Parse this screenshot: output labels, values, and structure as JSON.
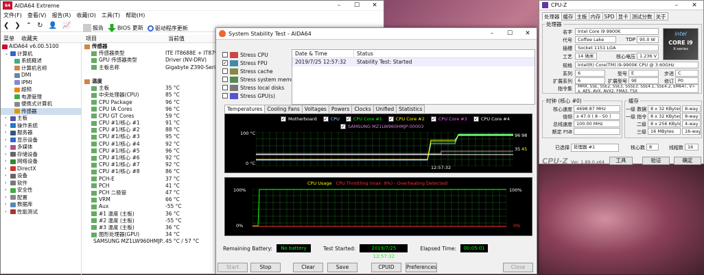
{
  "aida": {
    "title": "AIDA64 Extreme",
    "icon": "64",
    "menu": [
      "文件(F)",
      "查看(V)",
      "报告(R)",
      "收藏(O)",
      "工具(T)",
      "帮助(H)"
    ],
    "toolbar2": [
      "报告",
      "BIOS 更新",
      "驱动程序更新"
    ],
    "col_menu": "菜单",
    "col_fav": "收藏夹",
    "col_item": "项目",
    "col_value": "当前值",
    "version": "AIDA64 v6.00.5100",
    "tree": [
      "计算机",
      "系统概述",
      "计算机名称",
      "DMI",
      "IPMI",
      "超频",
      "电源管理",
      "便携式计算机",
      "传感器",
      "主板",
      "操作系统",
      "服务器",
      "显示设备",
      "多媒体",
      "存储设备",
      "网络设备",
      "DirectX",
      "设备",
      "软件",
      "安全性",
      "配置",
      "数据库",
      "性能测试"
    ],
    "sensors": [
      {
        "n": "传感器",
        "v": "",
        "h": 1
      },
      {
        "n": "传感器类型",
        "v": "ITE IT8688E + IT8795E",
        "h": 0
      },
      {
        "n": "GPU 传感器类型",
        "v": "Driver (NV-DRV)",
        "h": 0
      },
      {
        "n": "主板名称",
        "v": "Gigabyte Z390-Series",
        "h": 0
      },
      {
        "n": "",
        "v": "",
        "h": 0
      },
      {
        "n": "温度",
        "v": "",
        "h": 1
      },
      {
        "n": "主板",
        "v": "35 °C",
        "h": 0
      },
      {
        "n": "中央处理器(CPU)",
        "v": "85 °C",
        "h": 0
      },
      {
        "n": "CPU Package",
        "v": "96 °C",
        "h": 0
      },
      {
        "n": "CPU IA Cores",
        "v": "96 °C",
        "h": 0
      },
      {
        "n": "CPU GT Cores",
        "v": "59 °C",
        "h": 0
      },
      {
        "n": "CPU #1/核心 #1",
        "v": "91 °C",
        "h": 0
      },
      {
        "n": "CPU #1/核心 #2",
        "v": "88 °C",
        "h": 0
      },
      {
        "n": "CPU #1/核心 #3",
        "v": "95 °C",
        "h": 0
      },
      {
        "n": "CPU #1/核心 #4",
        "v": "92 °C",
        "h": 0
      },
      {
        "n": "CPU #1/核心 #5",
        "v": "96 °C",
        "h": 0
      },
      {
        "n": "CPU #1/核心 #6",
        "v": "92 °C",
        "h": 0
      },
      {
        "n": "CPU #1/核心 #7",
        "v": "92 °C",
        "h": 0
      },
      {
        "n": "CPU #1/核心 #8",
        "v": "86 °C",
        "h": 0
      },
      {
        "n": "PCH-E",
        "v": "37 °C",
        "h": 0
      },
      {
        "n": "PCH",
        "v": "41 °C",
        "h": 0
      },
      {
        "n": "PCH 二极管",
        "v": "47 °C",
        "h": 0
      },
      {
        "n": "VRM",
        "v": "66 °C",
        "h": 0
      },
      {
        "n": "Aux",
        "v": "-55 °C",
        "h": 0
      },
      {
        "n": "#1 温度 (主板)",
        "v": "36 °C",
        "h": 0
      },
      {
        "n": "#2 温度 (主板)",
        "v": "-55 °C",
        "h": 0
      },
      {
        "n": "#3 温度 (主板)",
        "v": "36 °C",
        "h": 0
      },
      {
        "n": "图形处理器(GPU)",
        "v": "34 °C",
        "h": 0
      },
      {
        "n": "SAMSUNG MZ1LW960HMJP...",
        "v": "45 °C / 57 °C",
        "h": 0
      }
    ]
  },
  "stab": {
    "title": "System Stability Test - AIDA64",
    "checks": [
      {
        "l": "Stress CPU",
        "c": false
      },
      {
        "l": "Stress FPU",
        "c": true
      },
      {
        "l": "Stress cache",
        "c": false
      },
      {
        "l": "Stress system memory",
        "c": false
      },
      {
        "l": "Stress local disks",
        "c": false
      },
      {
        "l": "Stress GPU(s)",
        "c": false
      }
    ],
    "log_h": [
      "Date & Time",
      "Status"
    ],
    "log_row": [
      "2019/7/25 12:57:32",
      "Stability Test: Started"
    ],
    "tabs": [
      "Temperatures",
      "Cooling Fans",
      "Voltages",
      "Powers",
      "Clocks",
      "Unified",
      "Statistics"
    ],
    "legend": [
      "Motherboard",
      "CPU",
      "CPU Core #1",
      "CPU Core #2",
      "CPU Core #3",
      "CPU Core #4"
    ],
    "legend2": "SAMSUNG MZ1LW960HMJP-00003",
    "t_top": "100 °C",
    "t_bot": "0 °C",
    "t_time": "12:57:32",
    "t_r1": "96",
    "t_r2": "98",
    "t_r3": "35",
    "t_r4": "45",
    "u_title": "CPU Usage",
    "u_throttle": "CPU Throttling (max: 9%) - Overheating Detected!",
    "u_top": "100%",
    "u_bot": "0%",
    "u_rtop": "100%",
    "u_rbot": "0%",
    "rb_l": "Remaining Battery:",
    "rb_v": "No battery",
    "ts_l": "Test Started:",
    "ts_v": "2019/7/25 12:57:32",
    "et_l": "Elapsed Time:",
    "et_v": "00:05:01",
    "buttons": [
      "Start",
      "Stop",
      "Clear",
      "Save",
      "CPUID",
      "Preferences",
      "Close"
    ]
  },
  "cpuz": {
    "title": "CPU-Z",
    "tabs": [
      "处理器",
      "缓存",
      "主板",
      "内存",
      "SPD",
      "显卡",
      "测试分数",
      "关于"
    ],
    "grp_proc": "处理器",
    "name_l": "名字",
    "name": "Intel Core i9 9900K",
    "code_l": "代号",
    "code": "Coffee Lake",
    "tdp_l": "TDP",
    "tdp": "95.0 W",
    "pkg_l": "插槽",
    "pkg": "Socket 1151 LGA",
    "tech_l": "工艺",
    "tech": "14 纳米",
    "volt_l": "核心电压",
    "volt": "1.236 V",
    "spec_l": "规格",
    "spec": "Intel(R) Core(TM) i9-9900K CPU @ 3.60GHz",
    "fam_l": "系列",
    "fam": "6",
    "mod_l": "型号",
    "mod": "E",
    "step_l": "步进",
    "step": "C",
    "efam_l": "扩展系列",
    "efam": "6",
    "emod_l": "扩展型号",
    "emod": "9E",
    "rev_l": "修订",
    "rev": "P0",
    "ins_l": "指令集",
    "ins": "MMX, SSE, SSE2, SSE3, SSSE3, SSE4.1, SSE4.2, EM64T, VT-x, AES, AVX, AVX2, FMA3, TSX",
    "grp_clk": "时钟 (核心 #0)",
    "cs_l": "核心速度",
    "cs": "4698.87 MHz",
    "mul_l": "倍频",
    "mul": "x 47.0 ( 8 - 50 )",
    "bus_l": "总线速度",
    "bus": "100.00 MHz",
    "fsb_l": "额定 FSB",
    "fsb": "",
    "grp_cache": "缓存",
    "l1d_l": "一级 数据",
    "l1d": "8 x 32 KBytes",
    "l1d_w": "8-way",
    "l1i_l": "一级 指令",
    "l1i": "8 x 32 KBytes",
    "l1i_w": "8-way",
    "l2_l": "二级",
    "l2": "8 x 256 KBytes",
    "l2_w": "4-way",
    "l3_l": "三级",
    "l3": "16 MBytes",
    "l3_w": "16-way",
    "sel_l": "已选择",
    "sel": "处理器 #1",
    "cores_l": "核心数",
    "cores": "8",
    "thr_l": "线程数",
    "thr": "16",
    "brand": "CPU-Z",
    "ver": "Ver. 1.89.0.x64",
    "tools": "工具",
    "verify": "验证",
    "ok": "确定",
    "logo1": "intel",
    "logo2": "CORE i9",
    "logo3": "X-series"
  }
}
